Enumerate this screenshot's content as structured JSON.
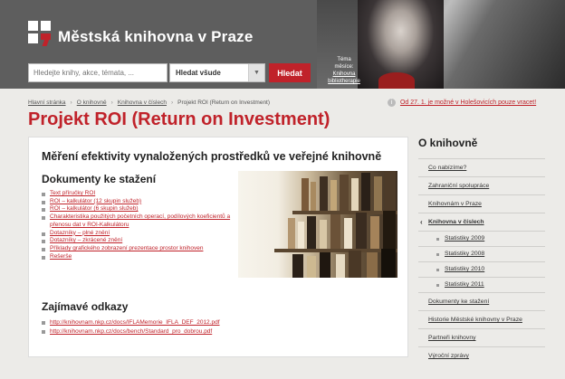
{
  "header": {
    "logo_text": "Městská knihovna v Praze",
    "search_placeholder": "Hledejte knihy, akce, témata, ...",
    "search_scope": "Hledat všude",
    "search_button": "Hledat",
    "hero_caption_line1": "Téma měsíce:",
    "hero_caption_link": "Knihovna",
    "hero_caption_link2": "bibliotherapie"
  },
  "breadcrumb": {
    "items": [
      "Hlavní stránka",
      "O knihovně",
      "Knihovna v číslech",
      "Projekt ROI (Return on Investment)"
    ]
  },
  "notice": {
    "text": "Od 27. 1. je možné v Holešovicích pouze vracet!"
  },
  "page_title": "Projekt ROI (Return on Investment)",
  "main": {
    "heading": "Měření efektivity vynaložených prostředků ve veřejné knihovně",
    "docs_heading": "Dokumenty ke stažení",
    "docs": [
      "Text příručky ROI",
      "ROI – kalkulátor (12 skupin služeb)",
      "ROI – kalkulátor (6 skupin služeb)",
      "Charakteristika použitých početních operací, podílových koeficientů a přenosu dat v ROI-Kalkulátoru",
      "Dotazníky – plné znění",
      "Dotazníky – zkrácené znění",
      "Příklady grafického zobrazení prezentace prostor knihoven",
      "Rešerše"
    ],
    "links_heading": "Zajímavé odkazy",
    "links": [
      "http://knihovnam.nkp.cz/docs/IFLAMemorie_IFLA_DEF_2012.pdf",
      "http://knihovnam.nkp.cz/docs/bench/Standard_pro_dobrou.pdf"
    ]
  },
  "sidebar": {
    "title": "O knihovně",
    "items": [
      "Co nabízíme?",
      "Zahraniční spolupráce",
      "Knihovnám v Praze",
      "Knihovna v číslech",
      "Statistiky 2009",
      "Statistiky 2008",
      "Statistiky 2010",
      "Statistiky 2011",
      "Dokumenty ke stažení",
      "Historie Městské knihovny v Praze",
      "Partneři knihovny",
      "Výroční zprávy"
    ]
  },
  "colors": {
    "brand_red": "#c0222a",
    "header_gray": "#5e5e5e",
    "page_bg": "#ecebe8"
  }
}
